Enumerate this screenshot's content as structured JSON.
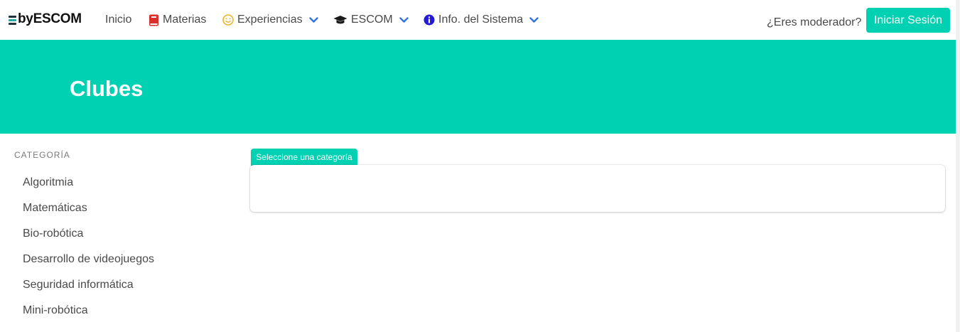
{
  "brand": {
    "name": "byESCOM"
  },
  "nav": {
    "items": [
      {
        "label": "Inicio",
        "icon": "",
        "dropdown": false
      },
      {
        "label": "Materias",
        "icon": "book-icon",
        "dropdown": false
      },
      {
        "label": "Experiencias",
        "icon": "smile-icon",
        "dropdown": true
      },
      {
        "label": "ESCOM",
        "icon": "graduation-cap-icon",
        "dropdown": true
      },
      {
        "label": "Info. del Sistema",
        "icon": "info-circle-icon",
        "dropdown": true
      }
    ],
    "moderator_text": "¿Eres moderador?",
    "login_label": "Iniciar Sesión"
  },
  "hero": {
    "title": "Clubes"
  },
  "sidebar": {
    "label": "CATEGORÍA",
    "items": [
      {
        "label": "Algoritmia"
      },
      {
        "label": "Matemáticas"
      },
      {
        "label": "Bio-robótica"
      },
      {
        "label": "Desarrollo de videojuegos"
      },
      {
        "label": "Seguridad informática"
      },
      {
        "label": "Mini-robótica"
      }
    ]
  },
  "content": {
    "tag_label": "Seleccione una categoría",
    "panel_text": ""
  },
  "colors": {
    "primary": "#00d1b2",
    "text": "#4a4a4a",
    "link_chevron": "#3273dc",
    "book_red": "#d9302c",
    "smile_yellow": "#f0b429"
  }
}
